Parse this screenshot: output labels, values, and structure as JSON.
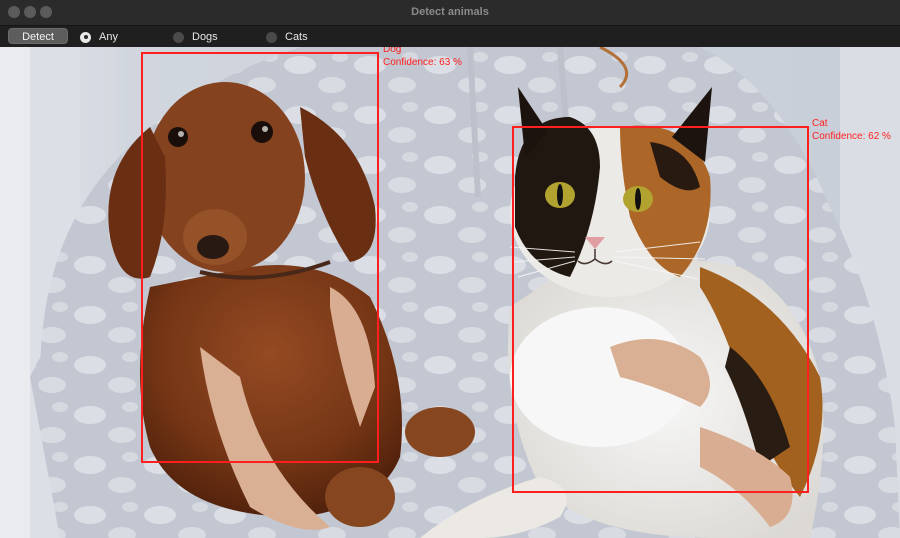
{
  "window": {
    "title": "Detect animals"
  },
  "toolbar": {
    "detect_label": "Detect",
    "filters": [
      {
        "label": "Any",
        "checked": true
      },
      {
        "label": "Dogs",
        "checked": false
      },
      {
        "label": "Cats",
        "checked": false
      }
    ]
  },
  "detections": [
    {
      "label": "Dog",
      "confidence_text": "Confidence: 63 %",
      "confidence": 63
    },
    {
      "label": "Cat",
      "confidence_text": "Confidence: 62 %",
      "confidence": 62
    }
  ],
  "colors": {
    "bbox": "#ff1f1f"
  }
}
